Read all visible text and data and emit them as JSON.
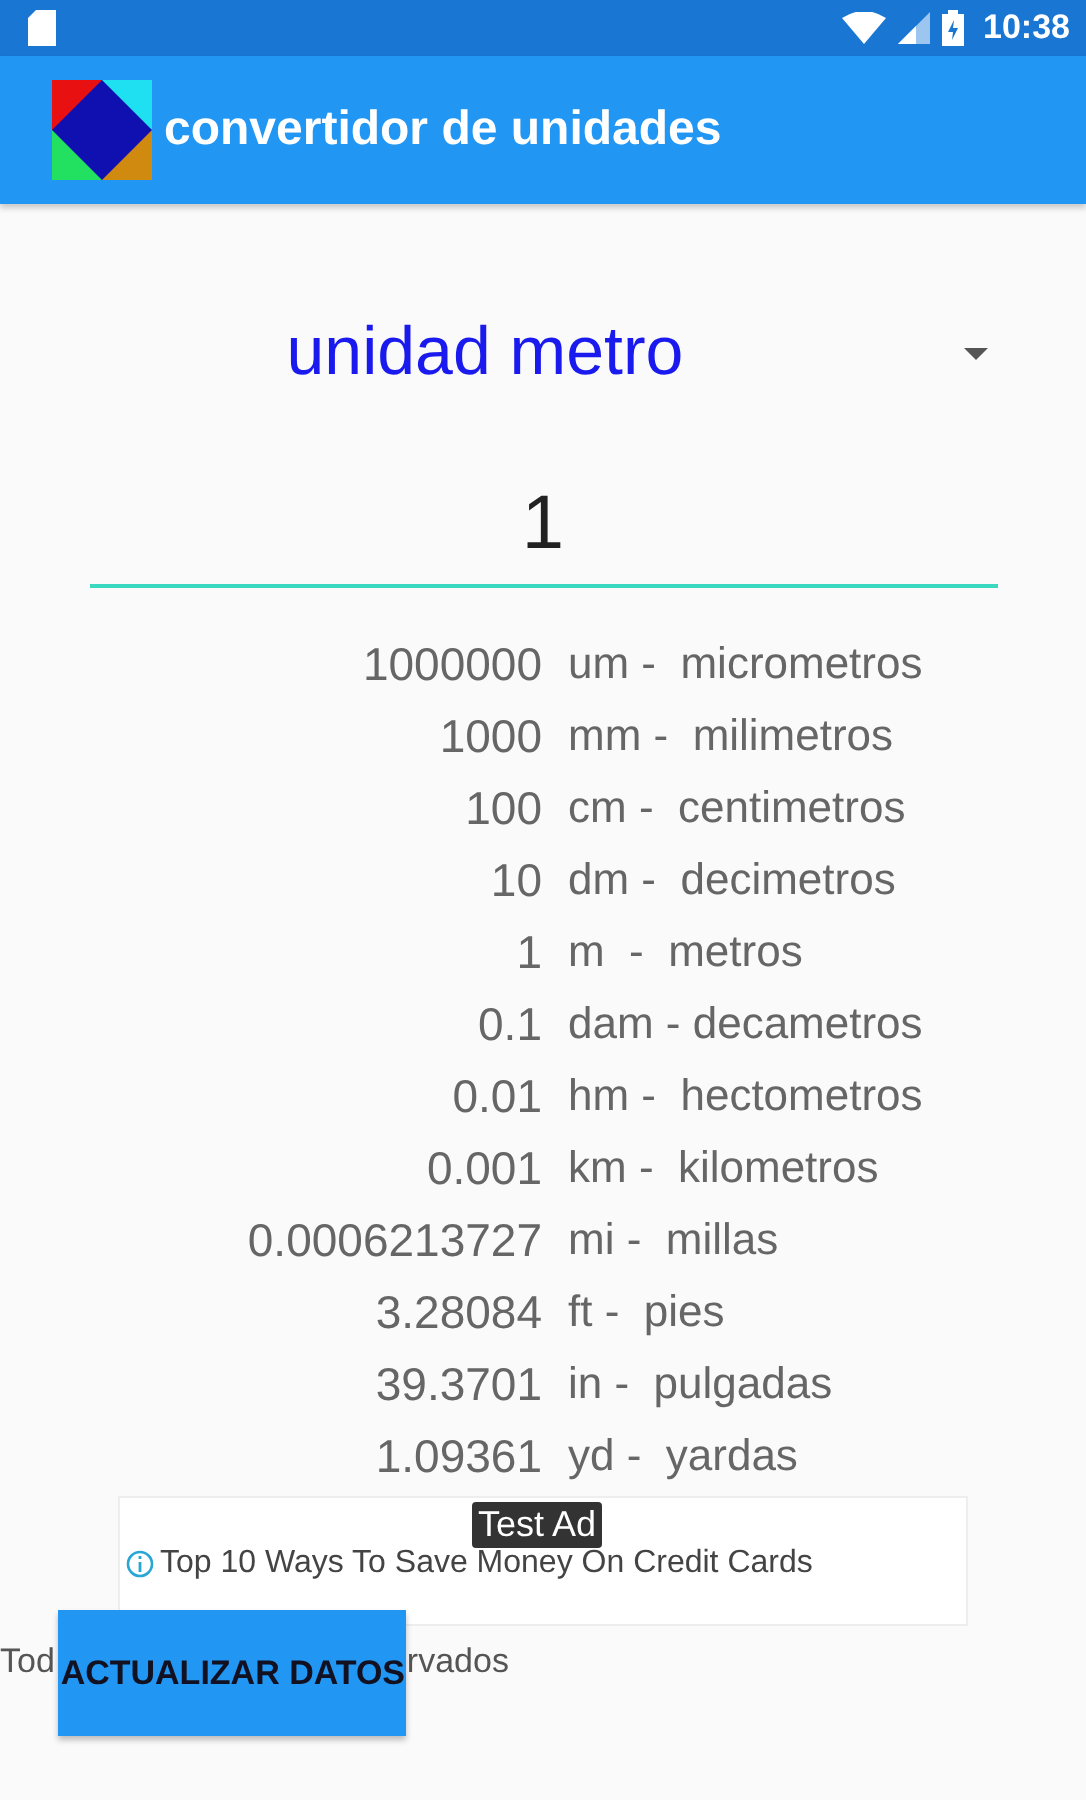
{
  "status_bar": {
    "time": "10:38"
  },
  "app_bar": {
    "title": "convertidor de unidades"
  },
  "unit_spinner": {
    "value": "unidad metro"
  },
  "amount_field": {
    "value": "1"
  },
  "results": [
    {
      "value": "1000000",
      "unit": "um -  micrometros"
    },
    {
      "value": "1000",
      "unit": "mm -  milimetros"
    },
    {
      "value": "100",
      "unit": "cm -  centimetros"
    },
    {
      "value": "10",
      "unit": "dm -  decimetros"
    },
    {
      "value": "1",
      "unit": "m  -  metros"
    },
    {
      "value": "0.1",
      "unit": "dam - decametros"
    },
    {
      "value": "0.01",
      "unit": "hm -  hectometros"
    },
    {
      "value": "0.001",
      "unit": "km -  kilometros"
    },
    {
      "value": "0.0006213727",
      "unit": "mi -  millas"
    },
    {
      "value": "3.28084",
      "unit": "ft -  pies"
    },
    {
      "value": "39.3701",
      "unit": "in -  pulgadas"
    },
    {
      "value": "1.09361",
      "unit": "yd -  yardas"
    }
  ],
  "ad": {
    "badge": "Test Ad",
    "text": "Top 10 Ways To Save Money On Credit Cards"
  },
  "footer": {
    "text_before": "Tod",
    "text_after": "rvados",
    "button": "ACTUALIZAR DATOS"
  }
}
